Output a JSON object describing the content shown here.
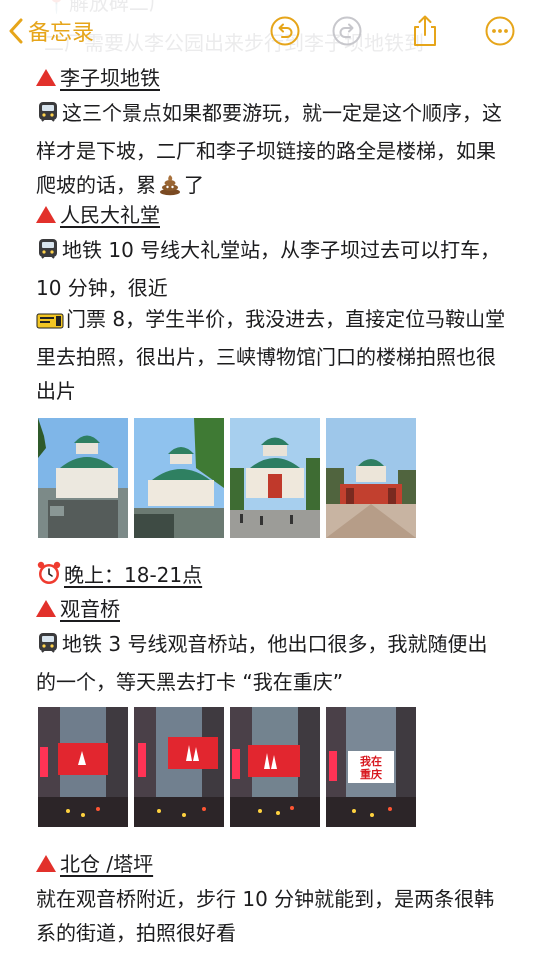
{
  "nav": {
    "back_label": "备忘录",
    "ghost_line1": "📍解放碑二厂",
    "ghost_line2": "二厂需要从李公园出来步行到李子坝地铁到"
  },
  "sections": {
    "liziba": {
      "title": "李子坝地铁",
      "body": "这三个景点如果都要游玩，就一定是这个顺序，这样才是下坡，二厂和李子坝链接的路全是楼梯，如果爬坡的话，累",
      "body_end": "了"
    },
    "renmin": {
      "title": "人民大礼堂",
      "line1": "地铁 10 号线大礼堂站，从李子坝过去可以打车，10 分钟，很近",
      "line2": "门票 8，学生半价，我没进去，直接定位马鞍山堂里去拍照，很出片，三峡博物馆门口的楼梯拍照也很出片"
    },
    "evening": {
      "title": "晚上：18-21点"
    },
    "guanyin": {
      "title": "观音桥",
      "body": "地铁 3 号线观音桥站，他出口很多，我就随便出的一个，等天黑去打卡 “我在重庆”",
      "billboard_text": "我在\n重庆"
    },
    "beicang": {
      "title": "北仓 /塔坪",
      "body": "就在观音桥附近，步行 10 分钟就能到，是两条很韩系的街道，拍照很好看"
    }
  },
  "icons": {
    "back": "chevron-left-icon",
    "undo": "undo-icon",
    "redo": "redo-icon",
    "share": "share-icon",
    "more": "more-icon",
    "heading_marker": "red-triangle-icon",
    "metro": "metro-train-icon",
    "ticket": "ticket-icon",
    "poop": "poop-icon",
    "alarm": "alarm-clock-icon"
  },
  "colors": {
    "accent": "#e6a51a",
    "marker": "#e2312b",
    "text": "#1c1c1e"
  }
}
